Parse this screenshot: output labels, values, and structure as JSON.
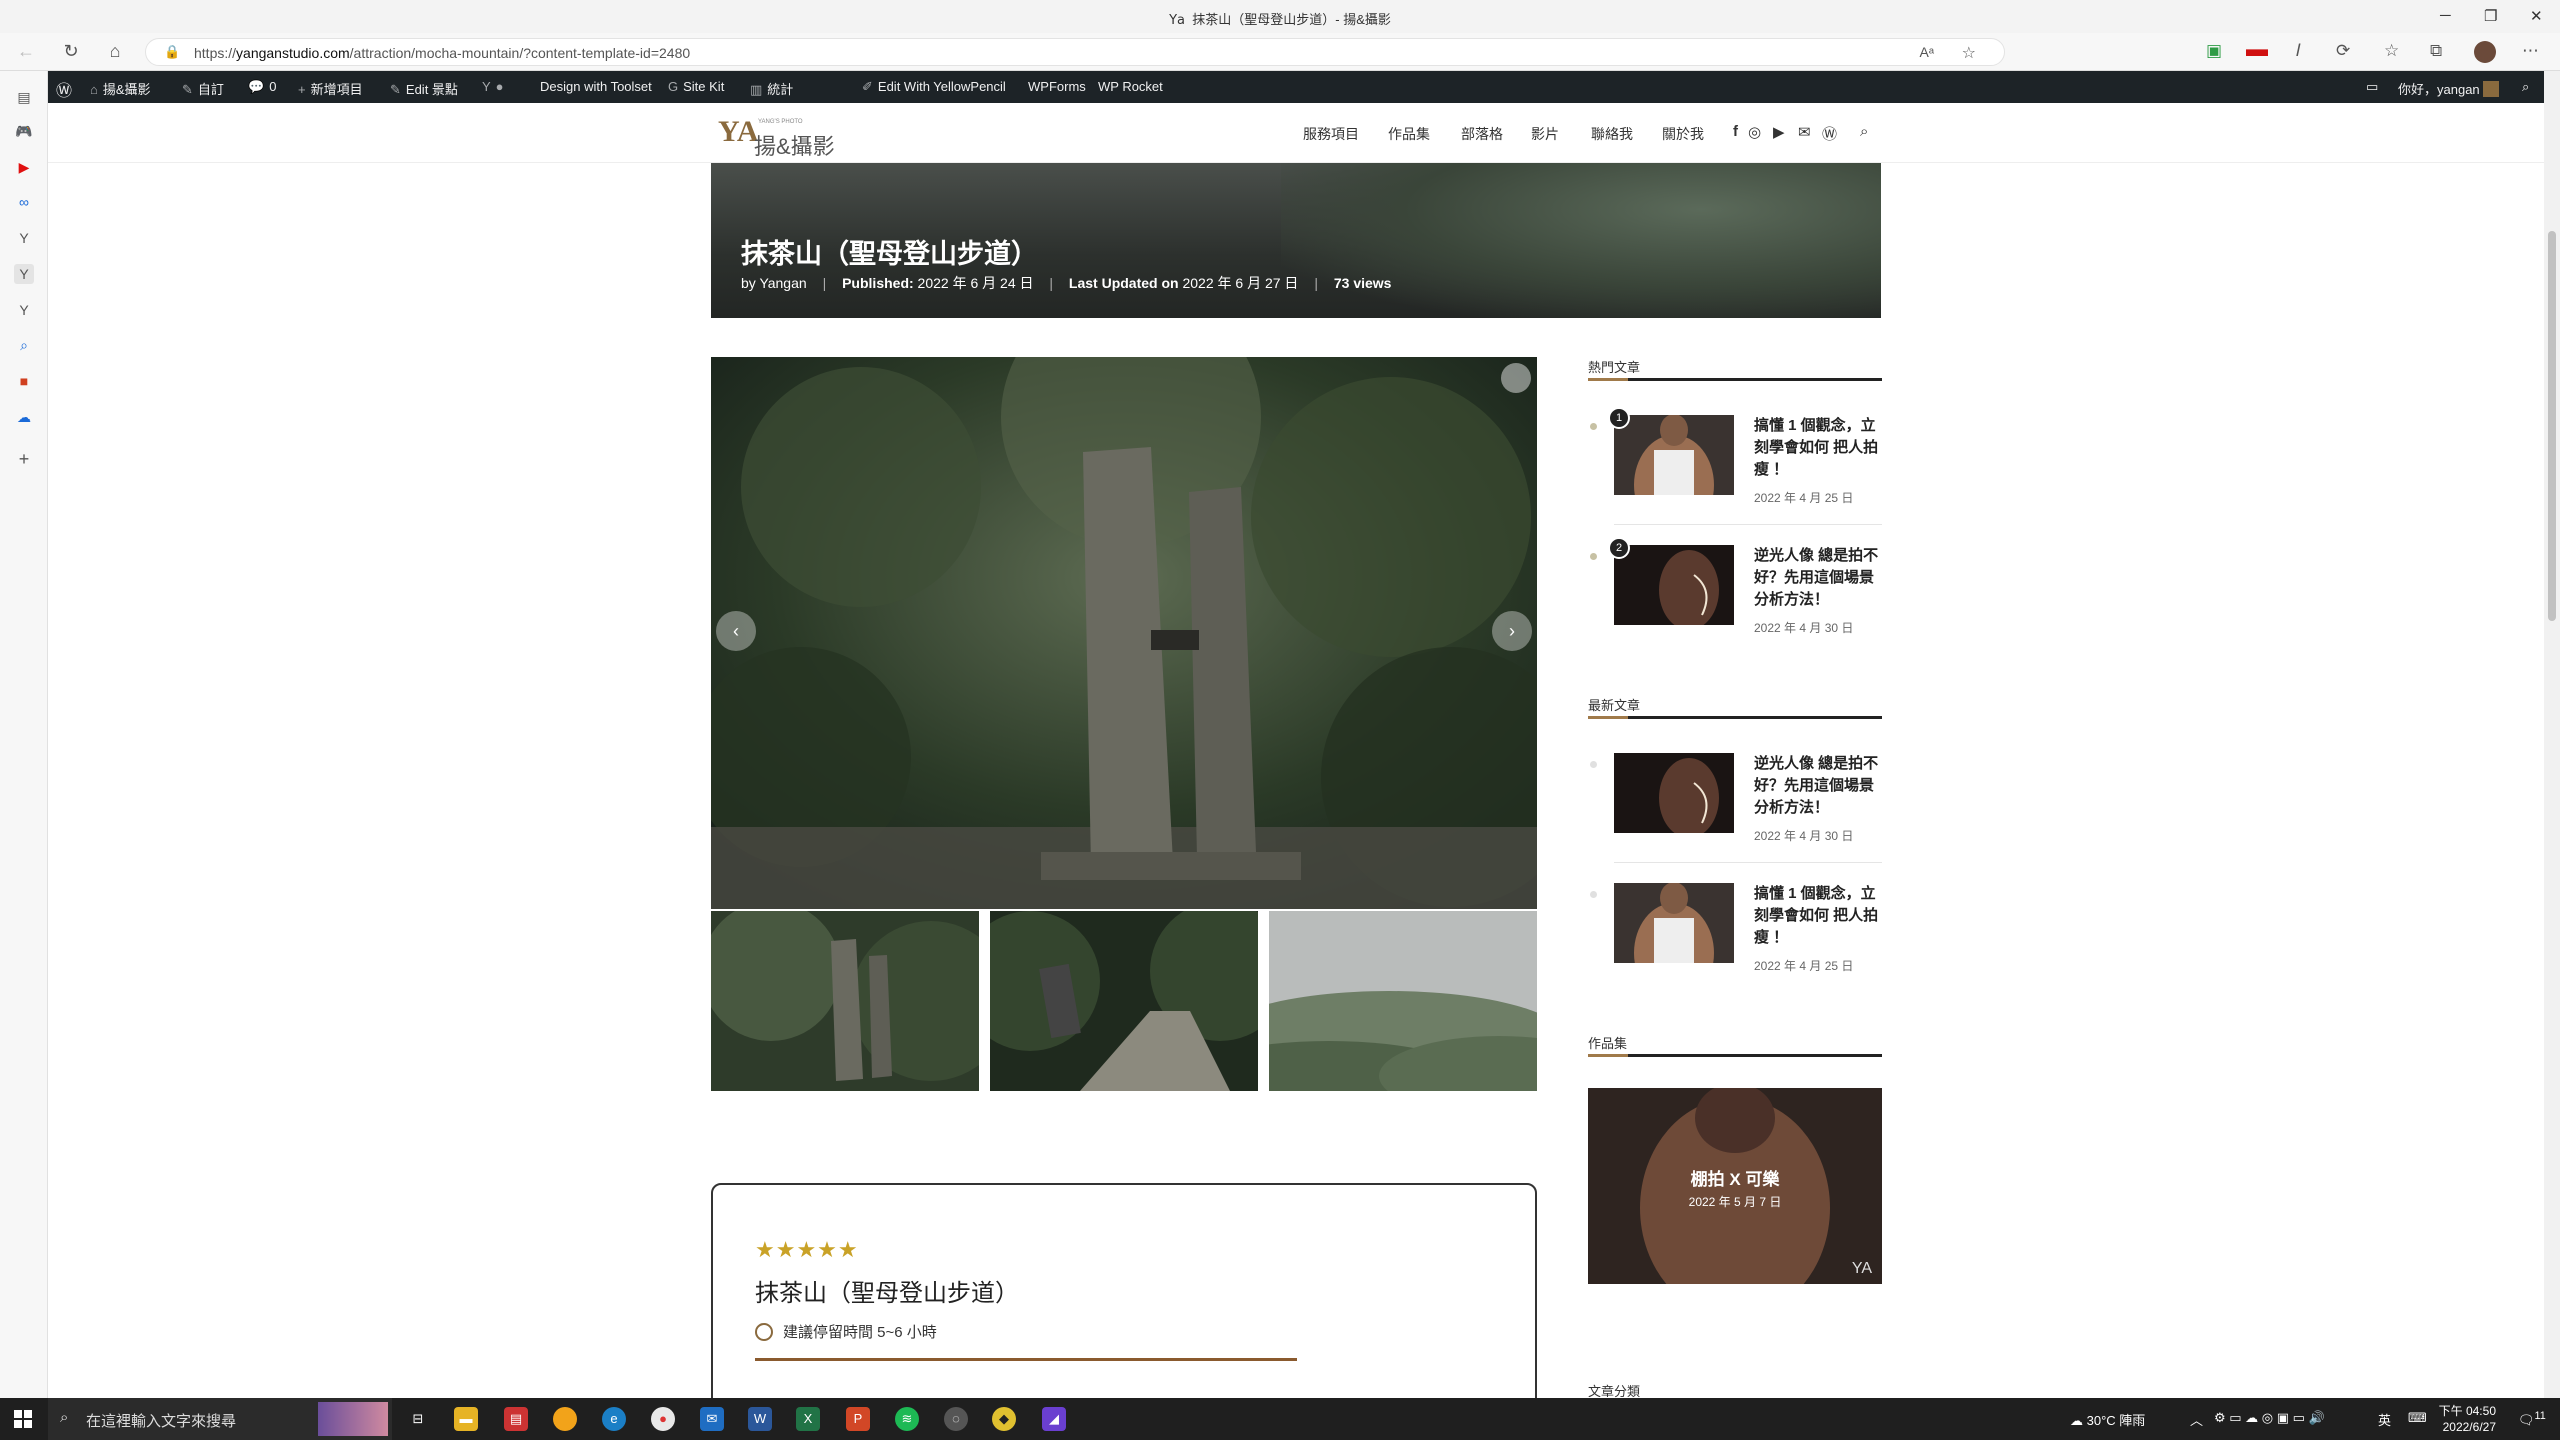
{
  "window": {
    "title": "抹茶山（聖母登山步道）- 揚&攝影",
    "title_icon": "𝖸𝖺"
  },
  "addressbar": {
    "url_prefix": "https://",
    "url_domain": "yanganstudio.com",
    "url_path": "/attraction/mocha-mountain/?content-template-id=2480"
  },
  "wpbar": {
    "site_name": "揚&攝影",
    "customize": "自訂",
    "comments": "0",
    "new": "新增項目",
    "edit": "Edit 景點",
    "toolset": "Design with Toolset",
    "sitekit": "Site Kit",
    "stats": "統計",
    "yellowpencil": "Edit With YellowPencil",
    "wpforms": "WPForms",
    "wprocket": "WP Rocket",
    "greeting": "你好，yangan"
  },
  "site": {
    "logo_mark": "YA",
    "logo_small": "YANG'S PHOTO",
    "logo_name": "揚&攝影",
    "nav": [
      "服務項目",
      "作品集",
      "部落格",
      "影片",
      "聯絡我",
      "關於我"
    ]
  },
  "article": {
    "title": "抹茶山（聖母登山步道）",
    "by_label": "by",
    "author": "Yangan",
    "published_label": "Published:",
    "published": "2022 年 6 月 24 日",
    "updated_label": "Last Updated on",
    "updated": "2022 年 6 月 27 日",
    "views": "73 views"
  },
  "card": {
    "rating": 5,
    "stars": "★★★★★",
    "title": "抹茶山（聖母登山步道）",
    "stay": "建議停留時間 5~6 小時"
  },
  "sidebar": {
    "popular_title": "熱門文章",
    "popular": [
      {
        "rank": "1",
        "title": "搞懂 1 個觀念，立刻學會如何 把人拍瘦 ！",
        "date": "2022 年 4 月 25 日"
      },
      {
        "rank": "2",
        "title": "逆光人像 總是拍不好？先用這個場景分析方法！",
        "date": "2022 年 4 月 30 日"
      }
    ],
    "latest_title": "最新文章",
    "latest": [
      {
        "title": "逆光人像 總是拍不好？先用這個場景分析方法！",
        "date": "2022 年 4 月 30 日"
      },
      {
        "title": "搞懂 1 個觀念，立刻學會如何 把人拍瘦 ！",
        "date": "2022 年 4 月 25 日"
      }
    ],
    "portfolio_title": "作品集",
    "portfolio_item": {
      "title": "棚拍 X 可樂",
      "date": "2022 年 5 月 7 日"
    },
    "categories_title": "文章分類"
  },
  "taskbar": {
    "search_placeholder": "在這裡輸入文字來搜尋",
    "weather": "30°C 陣雨",
    "ime": "英",
    "time": "下午 04:50",
    "date": "2022/6/27",
    "notif": "11"
  },
  "colors": {
    "accent": "#8a6a3e",
    "wpbar": "#1d2327",
    "star": "#c9a227"
  }
}
